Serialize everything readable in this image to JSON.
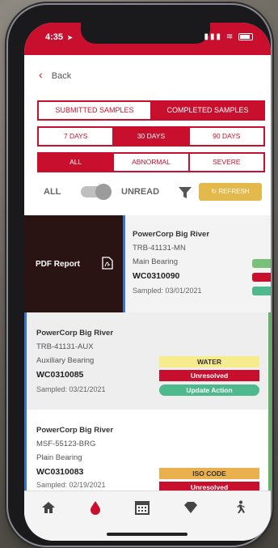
{
  "status": {
    "time": "4:35",
    "location_glyph": "➤",
    "signal": "▮▮▮",
    "wifi": "≋"
  },
  "nav": {
    "back_label": "Back"
  },
  "tabs_type": [
    {
      "label": "SUBMITTED SAMPLES",
      "active": false
    },
    {
      "label": "COMPLETED SAMPLES",
      "active": true
    }
  ],
  "tabs_range": [
    {
      "label": "7 DAYS",
      "active": false
    },
    {
      "label": "30 DAYS",
      "active": true
    },
    {
      "label": "90 DAYS",
      "active": false
    }
  ],
  "tabs_severity": [
    {
      "label": "ALL",
      "active": true
    },
    {
      "label": "ABNORMAL",
      "active": false
    },
    {
      "label": "SEVERE",
      "active": false
    }
  ],
  "filters": {
    "all_label": "ALL",
    "unread_label": "UNREAD",
    "refresh_label": "↻ REFRESH"
  },
  "samples": [
    {
      "pdf_label": "PDF Report",
      "title": "PowerCorp Big River",
      "asset": "TRB-41131-MN",
      "component": "Main Bearing",
      "wc": "WC0310090",
      "sampled": "Sampled: 03/01/2021"
    },
    {
      "title": "PowerCorp Big River",
      "asset": "TRB-41131-AUX",
      "component": "Auxiliary Bearing",
      "wc": "WC0310085",
      "sampled": "Sampled: 03/21/2021",
      "badge_type": "WATER",
      "badge_status": "Unresolved",
      "badge_action": "Update Action"
    },
    {
      "title": "PowerCorp Big River",
      "asset": "MSF-55123-BRG",
      "component": "Plain Bearing",
      "wc": "WC0310083",
      "sampled": "Sampled: 02/19/2021",
      "badge_type": "ISO CODE",
      "badge_status": "Unresolved"
    }
  ],
  "colors": {
    "brand_red": "#c8102e",
    "refresh_gold": "#e3b94b",
    "accent_blue": "#3b73c6",
    "action_green": "#4eb98d",
    "water_yellow": "#f6ec8d",
    "iso_orange": "#eab04e"
  },
  "tabbar_icons": [
    "home-icon",
    "drop-icon",
    "calendar-icon",
    "diamond-icon",
    "runner-icon"
  ]
}
